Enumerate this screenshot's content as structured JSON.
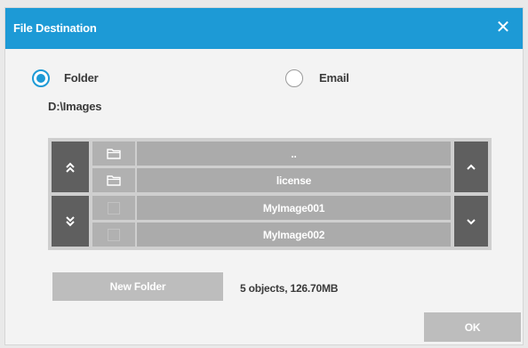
{
  "dialog": {
    "title": "File Destination",
    "close_glyph": "✕"
  },
  "destination": {
    "options": [
      {
        "label": "Folder",
        "selected": true
      },
      {
        "label": "Email",
        "selected": false
      }
    ],
    "path": "D:\\Images"
  },
  "file_list": {
    "rows": [
      {
        "name": "..",
        "icon": "folder-icon"
      },
      {
        "name": "license",
        "icon": "folder-icon"
      },
      {
        "name": "MyImage001",
        "icon": "file-icon"
      },
      {
        "name": "MyImage002",
        "icon": "file-icon"
      }
    ],
    "nav_icons": {
      "page_up": "double-chevron-up-icon",
      "page_down": "double-chevron-down-icon",
      "scroll_up": "chevron-up-icon",
      "scroll_down": "chevron-down-icon"
    }
  },
  "footer": {
    "new_folder_label": "New Folder",
    "status": "5 objects, 126.70MB",
    "ok_label": "OK"
  },
  "colors": {
    "accent": "#1d9ad6",
    "dark_button": "#5f5f5f",
    "row_background": "#ababab",
    "disabled_button": "#bdbdbd"
  }
}
